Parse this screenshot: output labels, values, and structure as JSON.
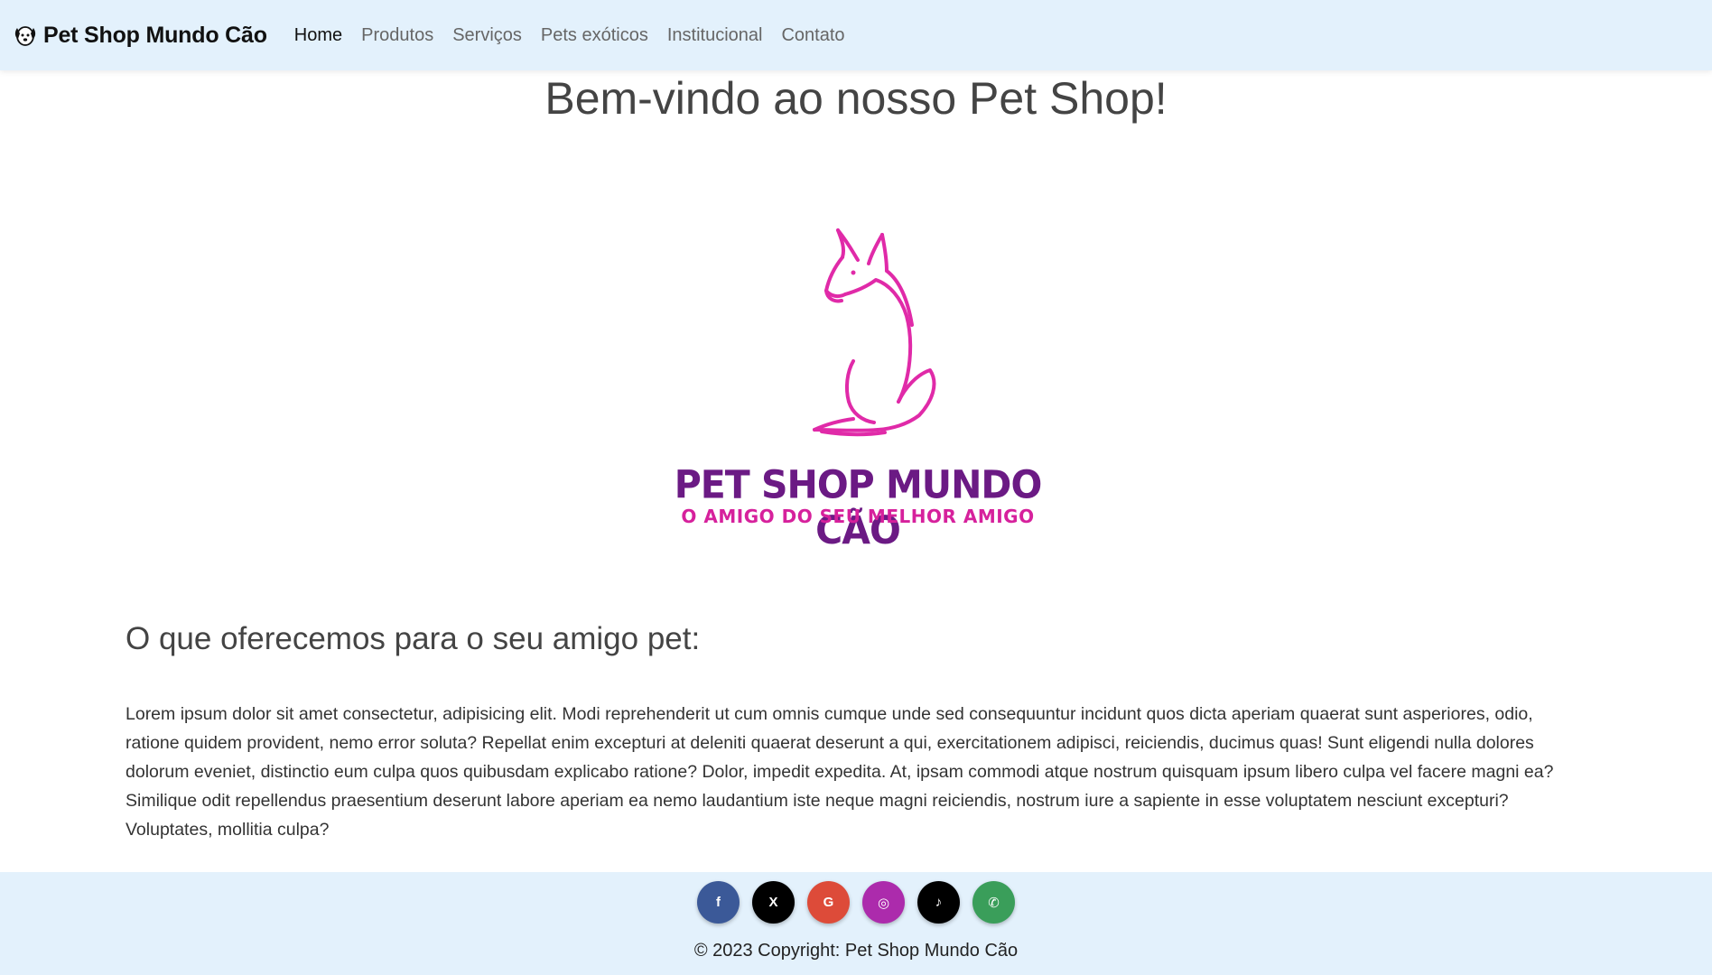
{
  "navbar": {
    "brand": "Pet Shop Mundo Cão",
    "links": [
      {
        "label": "Home",
        "active": true
      },
      {
        "label": "Produtos"
      },
      {
        "label": "Serviços"
      },
      {
        "label": "Pets exóticos"
      },
      {
        "label": "Institucional"
      },
      {
        "label": "Contato"
      }
    ]
  },
  "hero": {
    "title": "Bem-vindo ao nosso Pet Shop!",
    "logo_name": "PET SHOP MUNDO CÃO",
    "logo_tagline": "O AMIGO DO SEU MELHOR AMIGO",
    "logo_colors": {
      "dog": "#e02aa8",
      "name": "#6b1a84",
      "tagline": "#d6219c"
    }
  },
  "content": {
    "heading": "O que oferecemos para o seu amigo pet:",
    "paragraph": "Lorem ipsum dolor sit amet consectetur, adipisicing elit. Modi reprehenderit ut cum omnis cumque unde sed consequuntur incidunt quos dicta aperiam quaerat sunt asperiores, odio, ratione quidem provident, nemo error soluta? Repellat enim excepturi at deleniti quaerat deserunt a qui, exercitationem adipisci, reiciendis, ducimus quas! Sunt eligendi nulla dolores dolorum eveniet, distinctio eum culpa quos quibusdam explicabo ratione? Dolor, impedit expedita. At, ipsam commodi atque nostrum quisquam ipsum libero culpa vel facere magni ea? Similique odit repellendus praesentium deserunt labore aperiam ea nemo laudantium iste neque magni reiciendis, nostrum iure a sapiente in esse voluptatem nesciunt excepturi? Voluptates, mollitia culpa?"
  },
  "footer": {
    "socials": [
      {
        "icon": "facebook-icon",
        "glyph": "f",
        "color": "#3b5998"
      },
      {
        "icon": "x-icon",
        "glyph": "X",
        "color": "#000000"
      },
      {
        "icon": "google-icon",
        "glyph": "G",
        "color": "#dd4b39"
      },
      {
        "icon": "instagram-icon",
        "glyph": "◎",
        "color": "#ac2bac"
      },
      {
        "icon": "tiktok-icon",
        "glyph": "♪",
        "color": "#000000"
      },
      {
        "icon": "whatsapp-icon",
        "glyph": "✆",
        "color": "#3a9e5a"
      }
    ],
    "copyright": "© 2023 Copyright: Pet Shop Mundo Cão"
  }
}
